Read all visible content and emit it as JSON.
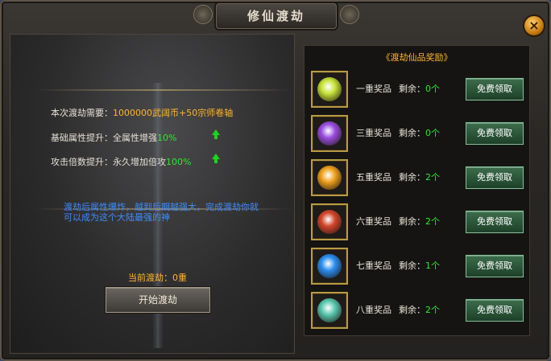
{
  "window": {
    "title": "修仙渡劫",
    "close_label": "×"
  },
  "left": {
    "cost_label": "本次渡劫需要：",
    "cost_value": "1000000武阔币+50宗师卷轴",
    "base_label": "基础属性提升：",
    "base_text": "全属性增强",
    "base_value": "10%",
    "attack_label": "攻击倍数提升：",
    "attack_text": "永久增加倍攻",
    "attack_value": "100%",
    "description": "渡劫后属性爆炸，越到后期越强大，完成渡劫你就可以成为这个大陆最强的神",
    "current_label": "当前渡劫：",
    "current_value": "0重",
    "start_button": "开始渡劫"
  },
  "rewards": {
    "title": "《渡劫仙品奖励》",
    "remain_label": "剩余：",
    "claim_label": "免费领取",
    "items": [
      {
        "name": "一重奖品",
        "count": "0个",
        "color": "#c8e33a"
      },
      {
        "name": "三重奖品",
        "count": "0个",
        "color": "#9b4de0"
      },
      {
        "name": "五重奖品",
        "count": "2个",
        "color": "#f0a21e"
      },
      {
        "name": "六重奖品",
        "count": "2个",
        "color": "#d2462b"
      },
      {
        "name": "七重奖品",
        "count": "1个",
        "color": "#2a8ef0"
      },
      {
        "name": "八重奖品",
        "count": "2个",
        "color": "#5ac8b0"
      }
    ]
  }
}
